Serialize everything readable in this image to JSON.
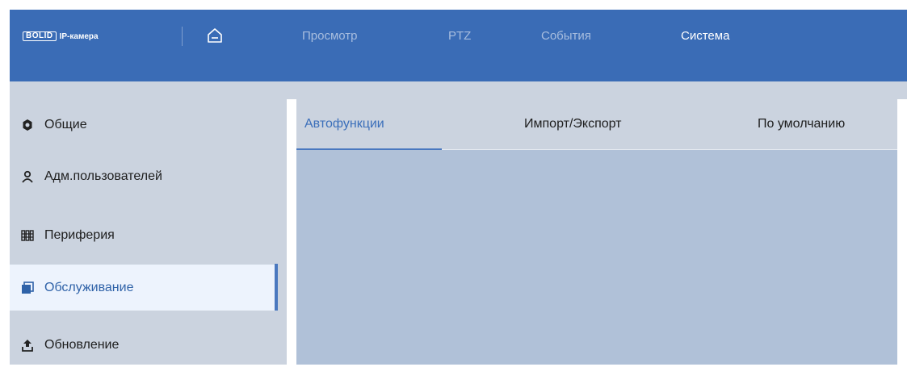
{
  "header": {
    "logo_brand": "BOLID",
    "logo_text": "IP-камера",
    "nav": [
      {
        "label": "Просмотр",
        "active": false
      },
      {
        "label": "PTZ",
        "active": false
      },
      {
        "label": "События",
        "active": false
      },
      {
        "label": "Система",
        "active": true
      }
    ]
  },
  "sidebar": {
    "items": [
      {
        "label": "Общие",
        "icon": "gear-icon"
      },
      {
        "label": "Адм.пользователей",
        "icon": "user-icon"
      },
      {
        "label": "Периферия",
        "icon": "peripheral-icon"
      },
      {
        "label": "Обслуживание",
        "icon": "maintenance-icon",
        "active": true
      },
      {
        "label": "Обновление",
        "icon": "upload-icon"
      }
    ]
  },
  "tabs": [
    {
      "label": "Автофункции",
      "active": true
    },
    {
      "label": "Импорт/Экспорт",
      "active": false
    },
    {
      "label": "По умолчанию",
      "active": false
    }
  ],
  "colors": {
    "header": "#3a6cb6",
    "sidebar": "#cbd3df",
    "content": "#b0c1d8",
    "accent": "#4a78bf",
    "active_item_bg": "#edf3fd"
  }
}
